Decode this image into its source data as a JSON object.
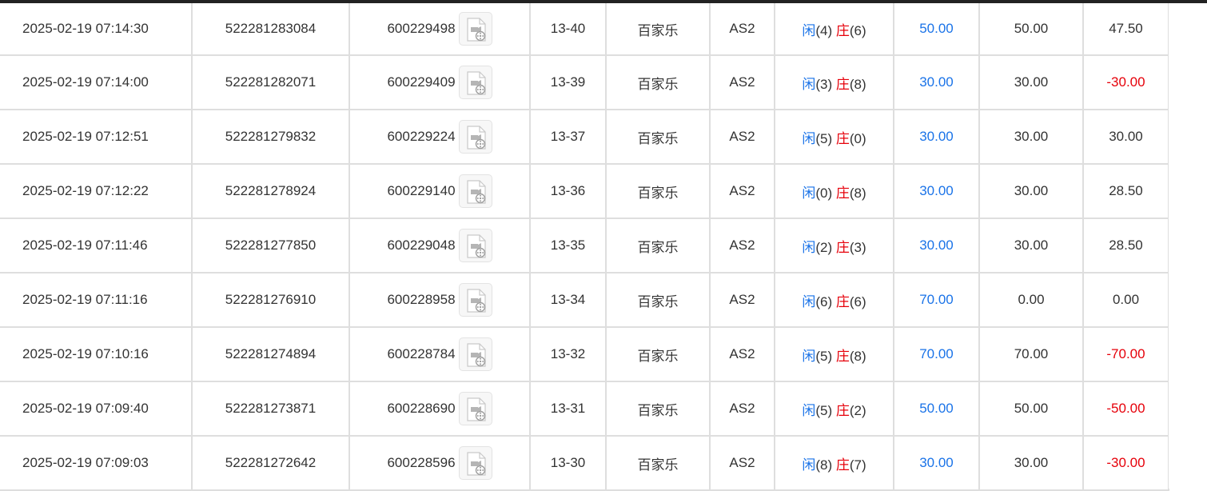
{
  "rows": [
    {
      "time": "2025-02-19 07:14:30",
      "bet_id": "522281283084",
      "round_id": "600229498",
      "shoe": "13-40",
      "game": "百家乐",
      "table": "AS2",
      "result": {
        "player_label": "闲",
        "player": "(4)",
        "banker_label": "庄",
        "banker": "(6)"
      },
      "bet": "50.00",
      "valid": "50.00",
      "payout": "47.50",
      "payout_negative": false
    },
    {
      "time": "2025-02-19 07:14:00",
      "bet_id": "522281282071",
      "round_id": "600229409",
      "shoe": "13-39",
      "game": "百家乐",
      "table": "AS2",
      "result": {
        "player_label": "闲",
        "player": "(3)",
        "banker_label": "庄",
        "banker": "(8)"
      },
      "bet": "30.00",
      "valid": "30.00",
      "payout": "-30.00",
      "payout_negative": true
    },
    {
      "time": "2025-02-19 07:12:51",
      "bet_id": "522281279832",
      "round_id": "600229224",
      "shoe": "13-37",
      "game": "百家乐",
      "table": "AS2",
      "result": {
        "player_label": "闲",
        "player": "(5)",
        "banker_label": "庄",
        "banker": "(0)"
      },
      "bet": "30.00",
      "valid": "30.00",
      "payout": "30.00",
      "payout_negative": false
    },
    {
      "time": "2025-02-19 07:12:22",
      "bet_id": "522281278924",
      "round_id": "600229140",
      "shoe": "13-36",
      "game": "百家乐",
      "table": "AS2",
      "result": {
        "player_label": "闲",
        "player": "(0)",
        "banker_label": "庄",
        "banker": "(8)"
      },
      "bet": "30.00",
      "valid": "30.00",
      "payout": "28.50",
      "payout_negative": false
    },
    {
      "time": "2025-02-19 07:11:46",
      "bet_id": "522281277850",
      "round_id": "600229048",
      "shoe": "13-35",
      "game": "百家乐",
      "table": "AS2",
      "result": {
        "player_label": "闲",
        "player": "(2)",
        "banker_label": "庄",
        "banker": "(3)"
      },
      "bet": "30.00",
      "valid": "30.00",
      "payout": "28.50",
      "payout_negative": false
    },
    {
      "time": "2025-02-19 07:11:16",
      "bet_id": "522281276910",
      "round_id": "600228958",
      "shoe": "13-34",
      "game": "百家乐",
      "table": "AS2",
      "result": {
        "player_label": "闲",
        "player": "(6)",
        "banker_label": "庄",
        "banker": "(6)"
      },
      "bet": "70.00",
      "valid": "0.00",
      "payout": "0.00",
      "payout_negative": false
    },
    {
      "time": "2025-02-19 07:10:16",
      "bet_id": "522281274894",
      "round_id": "600228784",
      "shoe": "13-32",
      "game": "百家乐",
      "table": "AS2",
      "result": {
        "player_label": "闲",
        "player": "(5)",
        "banker_label": "庄",
        "banker": "(8)"
      },
      "bet": "70.00",
      "valid": "70.00",
      "payout": "-70.00",
      "payout_negative": true
    },
    {
      "time": "2025-02-19 07:09:40",
      "bet_id": "522281273871",
      "round_id": "600228690",
      "shoe": "13-31",
      "game": "百家乐",
      "table": "AS2",
      "result": {
        "player_label": "闲",
        "player": "(5)",
        "banker_label": "庄",
        "banker": "(2)"
      },
      "bet": "50.00",
      "valid": "50.00",
      "payout": "-50.00",
      "payout_negative": true
    },
    {
      "time": "2025-02-19 07:09:03",
      "bet_id": "522281272642",
      "round_id": "600228596",
      "shoe": "13-30",
      "game": "百家乐",
      "table": "AS2",
      "result": {
        "player_label": "闲",
        "player": "(8)",
        "banker_label": "庄",
        "banker": "(7)"
      },
      "bet": "30.00",
      "valid": "30.00",
      "payout": "-30.00",
      "payout_negative": true
    }
  ],
  "icons": {
    "replay": "video-replay-icon"
  },
  "colors": {
    "player": "#1a73e8",
    "banker": "#e6000a",
    "bet": "#1a73e8",
    "negative_payout": "#e6000a",
    "text": "#333333",
    "grid": "#dedede"
  }
}
